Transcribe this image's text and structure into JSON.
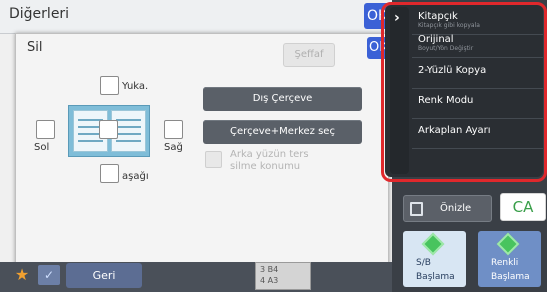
{
  "outer": {
    "title": "Diğerleri",
    "ok": "OK"
  },
  "dialog": {
    "title": "Sil",
    "ok": "OK",
    "seffaf": "Şeffaf",
    "positions": {
      "top": "Yuka.",
      "left": "Sol",
      "right": "Sağ",
      "bottom": "aşağı"
    },
    "edge_button": "Dış Çerçeve",
    "center_button": "Çerçeve+Merkez seç",
    "reverse_option": [
      "Arka yüzün ters",
      "silme konumu"
    ]
  },
  "bottom": {
    "back": "Geri",
    "trays": [
      "3  B4",
      "4  A3"
    ]
  },
  "menu": {
    "items": [
      {
        "label": "Kitapçık",
        "sub": "Kitapçık gibi kopyala"
      },
      {
        "label": "Orijinal",
        "sub": "Boyut/Yön Değiştir"
      },
      {
        "label": "2-Yüzlü Kopya",
        "sub": ""
      },
      {
        "label": "Renk Modu",
        "sub": ""
      },
      {
        "label": "Arkaplan Ayarı",
        "sub": ""
      }
    ]
  },
  "actions": {
    "preview": "Önizle",
    "ca": "CA",
    "bw_start": [
      "S/B",
      "Başlama"
    ],
    "color_start": [
      "Renkli",
      "Başlama"
    ]
  },
  "colors": {
    "accent": "#3b61d6",
    "highlight": "#e0282c",
    "start_icon": "#48c45e"
  }
}
